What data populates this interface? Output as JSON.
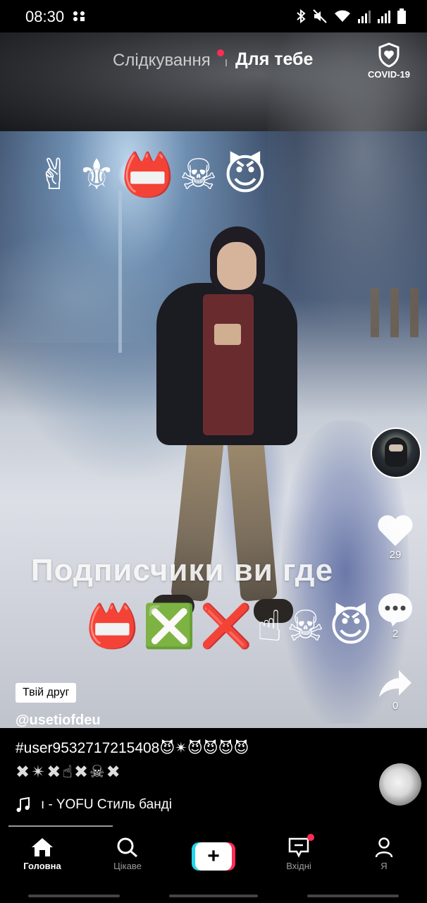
{
  "status_bar": {
    "time": "08:30"
  },
  "top_nav": {
    "following": "Слідкування",
    "for_you": "Для тебе",
    "covid_label": "COVID-19"
  },
  "video": {
    "emoji_top": [
      "✌",
      "⚜",
      "📛",
      "☠",
      "😈"
    ],
    "overlay_text": "Подписчики  ви  где",
    "emoji_bottom": [
      "📛",
      "❎",
      "❌",
      "☝",
      "☠",
      "😈"
    ]
  },
  "actions": {
    "likes": "29",
    "comments": "2",
    "shares": "0"
  },
  "post": {
    "friend_badge": "Твій друг",
    "username": "@usetiofdeu",
    "caption_tags": "#user9532717215408😈✴😈😈😈😈",
    "caption_emoji": "✖✴✖☝✖☠✖",
    "music": "ı - YOFU   Стиль банді"
  },
  "bottom_nav": {
    "home": "Головна",
    "discover": "Цікаве",
    "inbox": "Вхідні",
    "me": "Я",
    "create": "+"
  },
  "colors": {
    "accent_red": "#fe2c55",
    "accent_cyan": "#20d5ec"
  }
}
